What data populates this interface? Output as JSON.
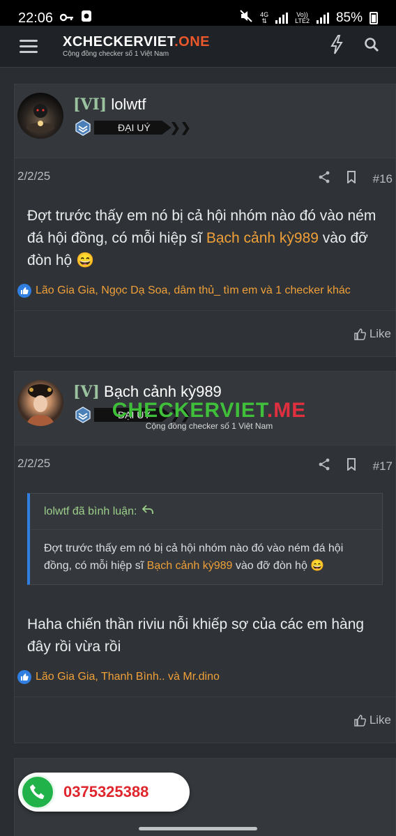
{
  "status_bar": {
    "time": "22:06",
    "net_4g": "4G",
    "volte_top": "Vo))",
    "volte_bottom": "LTE2",
    "battery": "85%"
  },
  "header": {
    "logo_main": "XCHECKERVIET",
    "logo_suffix": ".ONE",
    "logo_tagline": "Cộng đồng checker số 1 Việt Nam",
    "icons": [
      "menu-icon",
      "lightning-icon",
      "search-icon"
    ]
  },
  "posts": [
    {
      "user_tag": "[VI]",
      "username": "lolwtf",
      "rank": "ĐẠI UÝ",
      "date": "2/2/25",
      "post_number": "#16",
      "body": {
        "before": "Đợt trước thấy em nó bị cả hội nhóm nào đó vào ném đá hội đồng, có mỗi hiệp sĩ ",
        "mention": "Bạch cảnh kỳ989",
        "after": " vào đỡ đòn hộ 😄"
      },
      "reactions": "Lão Gia Gia, Ngọc Dạ Soa, dâm thủ_ tìm em và 1 checker khác",
      "like_label": "Like"
    },
    {
      "user_tag": "[V]",
      "username": "Bạch cảnh kỳ989",
      "rank": "ĐẠI UÝ",
      "date": "2/2/25",
      "post_number": "#17",
      "quote": {
        "author_line": "lolwtf đã bình luận:",
        "before": "Đợt trước thấy em nó bị cả hội nhóm nào đó vào ném đá hội đồng, có mỗi hiệp sĩ ",
        "mention": "Bạch cảnh kỳ989",
        "after": " vào đỡ đòn hộ 😄"
      },
      "body": "Haha chiến thần riviu nỗi khiếp sợ của các em hàng đây rồi vừa rồi",
      "reactions": "Lão Gia Gia, Thanh Bình.. và Mr.dino",
      "like_label": "Like"
    }
  ],
  "watermark": {
    "main": "CHECKERVIET",
    "suffix": ".ME",
    "tagline": "Cộng đồng checker số 1 Việt Nam"
  },
  "contact": {
    "phone": "0375325388",
    "icon": "phone-icon"
  }
}
